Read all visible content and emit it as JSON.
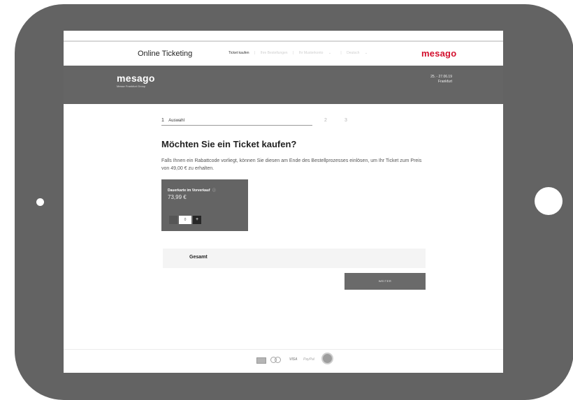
{
  "topnav": {
    "title": "Online Ticketing",
    "links": [
      "Ticket kaufen",
      "Ihre Bestellungen",
      "Ihr Musterkonto",
      "Deutsch"
    ],
    "logo": "mesago"
  },
  "band": {
    "logo": "mesago",
    "subtitle": "Messe Frankfurt Group",
    "date": "25. - 27.06.19",
    "city": "Frankfurt"
  },
  "steps": {
    "current_number": "1",
    "current_label": "Auswahl",
    "next": [
      "2",
      "3"
    ]
  },
  "main": {
    "headline": "Möchten Sie ein Ticket kaufen?",
    "text": "Falls Ihnen ein Rabattcode vorliegt, können Sie diesen am Ende des Bestellprozesses einlösen, um Ihr Ticket zum Preis von 49,00 € zu erhalten."
  },
  "ticket": {
    "name": "Dauerkarte im Vorverkauf",
    "info": "ⓘ",
    "price": "73,99 €",
    "quantity": "0",
    "minus": "",
    "plus": "+"
  },
  "total": {
    "label": "Gesamt"
  },
  "next_button": {
    "label": "WEITER"
  },
  "payments": {
    "visa": "VISA",
    "paypal": "PayPal"
  },
  "colors": {
    "brand_red": "#d3102e",
    "band_gray": "#656565",
    "tablet_frame": "#636363"
  }
}
